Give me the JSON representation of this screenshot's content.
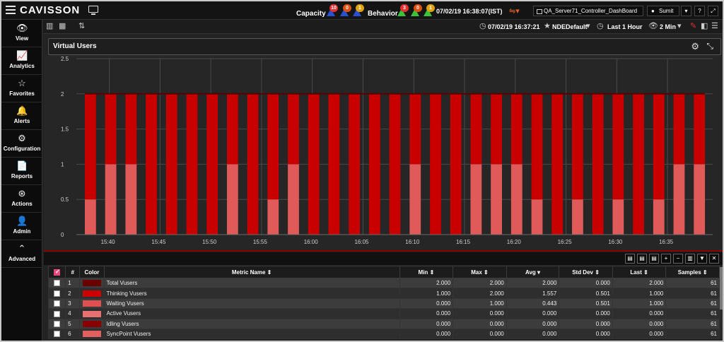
{
  "header": {
    "logo": "CAVISSON",
    "capacity_label": "Capacity",
    "capacity_badges": [
      {
        "count": "10",
        "color": "#e03030"
      },
      {
        "count": "0",
        "color": "#e05010"
      },
      {
        "count": "1",
        "color": "#e0a010"
      }
    ],
    "behavior_label": "Behavior",
    "behavior_badges": [
      {
        "count": "3",
        "color": "#e03030"
      },
      {
        "count": "0",
        "color": "#e05010"
      },
      {
        "count": "1",
        "color": "#e0a010"
      }
    ],
    "datetime": "07/02/19 16:38:07(IST)",
    "dashboard_name": "QA_Server71_Controller_DashBoard",
    "user": "Sumit"
  },
  "sidebar": {
    "items": [
      {
        "label": "View",
        "icon": "eye-icon",
        "glyph": "👁"
      },
      {
        "label": "Analytics",
        "icon": "line-chart-icon",
        "glyph": "📈"
      },
      {
        "label": "Favorites",
        "icon": "star-icon",
        "glyph": "☆"
      },
      {
        "label": "Alerts",
        "icon": "bell-icon",
        "glyph": "🔔"
      },
      {
        "label": "Configuration",
        "icon": "gears-icon",
        "glyph": "⚙"
      },
      {
        "label": "Reports",
        "icon": "document-icon",
        "glyph": "📄"
      },
      {
        "label": "Actions",
        "icon": "actions-icon",
        "glyph": "⊛"
      },
      {
        "label": "Admin",
        "icon": "user-icon",
        "glyph": "👤"
      },
      {
        "label": "Advanced",
        "icon": "chevron-up-circle-icon",
        "glyph": "⌃"
      }
    ]
  },
  "toolbar": {
    "timestamp": "07/02/19 16:37:21",
    "profile": "NDEDefault",
    "time_range": "Last 1 Hour",
    "interval": "2 Min"
  },
  "panel": {
    "title": "Virtual Users"
  },
  "chart_data": {
    "type": "bar",
    "stacked": true,
    "ylim": [
      0,
      2.5
    ],
    "yticks": [
      "0",
      "0.5",
      "1",
      "1.5",
      "2",
      "2.5"
    ],
    "xticks": [
      "15:40",
      "15:45",
      "15:50",
      "15:55",
      "16:00",
      "16:05",
      "16:10",
      "16:15",
      "16:20",
      "16:25",
      "16:30",
      "16:35"
    ],
    "grid": true,
    "series": [
      {
        "name": "Waiting Vusers",
        "color": "#e05a5a",
        "values": [
          0.5,
          1,
          1,
          0,
          0,
          0,
          0,
          1,
          0,
          0.5,
          1,
          0,
          0,
          0,
          0,
          0,
          1,
          0,
          0,
          1,
          1,
          1,
          0.5,
          0,
          0.5,
          0,
          0.5,
          0,
          0.5,
          1,
          1
        ]
      },
      {
        "name": "Thinking Vusers",
        "color": "#c80000",
        "values": [
          1.5,
          1,
          1,
          2,
          2,
          2,
          2,
          1,
          2,
          1.5,
          1,
          2,
          2,
          2,
          2,
          2,
          1,
          2,
          2,
          1,
          1,
          1,
          1.5,
          2,
          1.5,
          2,
          1.5,
          2,
          1.5,
          1,
          1
        ]
      }
    ],
    "total_line": {
      "name": "Total Vusers",
      "value": 2,
      "color": "#5a0000"
    }
  },
  "table": {
    "columns": [
      "#",
      "Color",
      "Metric Name",
      "Min",
      "Max",
      "Avg",
      "Std Dev",
      "Last",
      "Samples"
    ],
    "rows": [
      {
        "num": "1",
        "color": "#6a0000",
        "name": "Total Vusers",
        "min": "2.000",
        "max": "2.000",
        "avg": "2.000",
        "std": "0.000",
        "last": "2.000",
        "samples": "61"
      },
      {
        "num": "2",
        "color": "#cc0000",
        "name": "Thinking Vusers",
        "min": "1.000",
        "max": "2.000",
        "avg": "1.557",
        "std": "0.501",
        "last": "1.000",
        "samples": "61"
      },
      {
        "num": "3",
        "color": "#e05050",
        "name": "Waiting Vusers",
        "min": "0.000",
        "max": "1.000",
        "avg": "0.443",
        "std": "0.501",
        "last": "1.000",
        "samples": "61"
      },
      {
        "num": "4",
        "color": "#e87070",
        "name": "Active Vusers",
        "min": "0.000",
        "max": "0.000",
        "avg": "0.000",
        "std": "0.000",
        "last": "0.000",
        "samples": "61"
      },
      {
        "num": "5",
        "color": "#8a0000",
        "name": "Idling Vusers",
        "min": "0.000",
        "max": "0.000",
        "avg": "0.000",
        "std": "0.000",
        "last": "0.000",
        "samples": "61"
      },
      {
        "num": "6",
        "color": "#e06060",
        "name": "SyncPoint Vusers",
        "min": "0.000",
        "max": "0.000",
        "avg": "0.000",
        "std": "0.000",
        "last": "0.000",
        "samples": "61"
      }
    ]
  }
}
